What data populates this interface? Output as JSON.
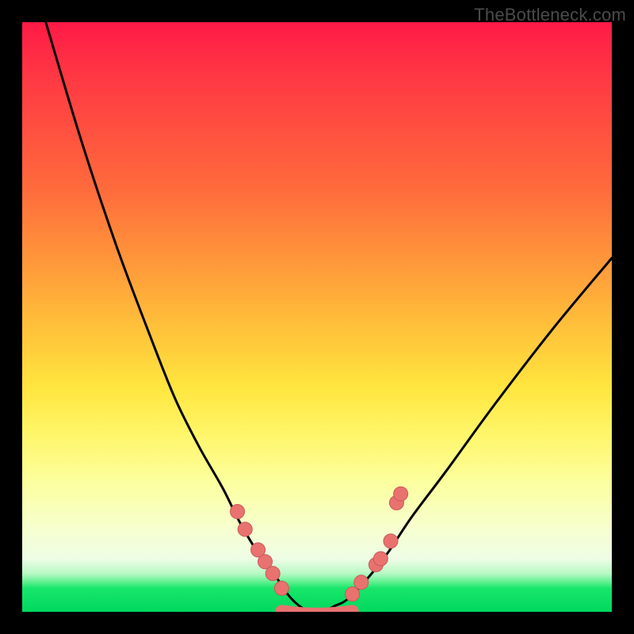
{
  "watermark": "TheBottleneck.com",
  "chart_data": {
    "type": "line",
    "title": "",
    "xlabel": "",
    "ylabel": "",
    "xlim": [
      0,
      100
    ],
    "ylim": [
      0,
      100
    ],
    "grid": false,
    "legend": false,
    "series": [
      {
        "name": "bottleneck-curve",
        "x": [
          4,
          10,
          16,
          22,
          26,
          30,
          34,
          37,
          40,
          43,
          45,
          47,
          49,
          51,
          53,
          55,
          58,
          62,
          66,
          72,
          80,
          90,
          100
        ],
        "y": [
          100,
          80,
          62,
          46,
          36,
          28,
          21,
          15,
          10,
          6,
          3,
          1,
          0,
          0,
          1,
          2,
          5,
          10,
          16,
          24,
          35,
          48,
          60
        ]
      }
    ],
    "markers_left": [
      {
        "x": 36.5,
        "y": 17
      },
      {
        "x": 37.8,
        "y": 14
      },
      {
        "x": 40.0,
        "y": 10.5
      },
      {
        "x": 41.2,
        "y": 8.5
      },
      {
        "x": 42.5,
        "y": 6.5
      },
      {
        "x": 44.0,
        "y": 4
      }
    ],
    "markers_right": [
      {
        "x": 56.0,
        "y": 3
      },
      {
        "x": 57.5,
        "y": 5
      },
      {
        "x": 60.0,
        "y": 8
      },
      {
        "x": 60.8,
        "y": 9
      },
      {
        "x": 62.5,
        "y": 12
      },
      {
        "x": 63.5,
        "y": 18.5
      },
      {
        "x": 64.2,
        "y": 20
      }
    ],
    "flat_band": {
      "x_start": 44,
      "x_end": 56,
      "y": 0.5
    },
    "colors": {
      "curve": "#000000",
      "marker_fill": "#e9726f",
      "marker_stroke": "#c85a57"
    }
  }
}
